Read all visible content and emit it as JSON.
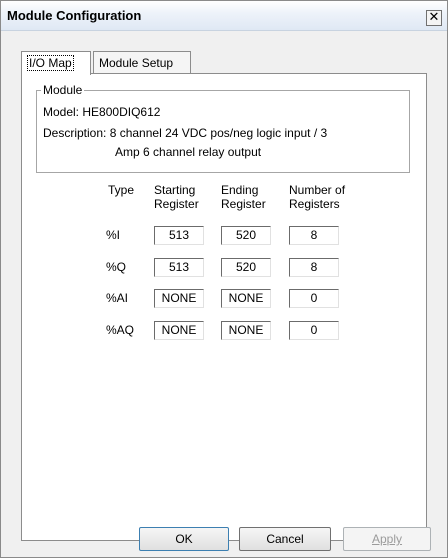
{
  "window": {
    "title": "Module Configuration",
    "close_glyph": "✕"
  },
  "tabs": [
    {
      "label": "I/O Map",
      "active": true
    },
    {
      "label": "Module Setup",
      "active": false
    }
  ],
  "module_group": {
    "legend": "Module",
    "model_label": "Model:",
    "model_value": "HE800DIQ612",
    "description_label": "Description:",
    "description_line1": "8 channel 24 VDC pos/neg logic input / 3",
    "description_line2": "Amp 6 channel relay output"
  },
  "io_table": {
    "headers": {
      "type": "Type",
      "start_1": "Starting",
      "start_2": "Register",
      "end_1": "Ending",
      "end_2": "Register",
      "num_1": "Number of",
      "num_2": "Registers"
    },
    "rows": [
      {
        "type": "%I",
        "start": "513",
        "end": "520",
        "count": "8"
      },
      {
        "type": "%Q",
        "start": "513",
        "end": "520",
        "count": "8"
      },
      {
        "type": "%AI",
        "start": "NONE",
        "end": "NONE",
        "count": "0"
      },
      {
        "type": "%AQ",
        "start": "NONE",
        "end": "NONE",
        "count": "0"
      }
    ]
  },
  "buttons": {
    "ok": "OK",
    "cancel": "Cancel",
    "apply": "Apply"
  }
}
